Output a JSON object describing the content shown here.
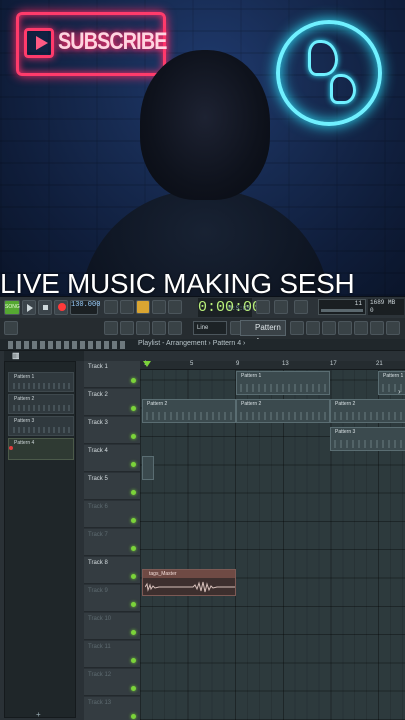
{
  "overlay": {
    "headline": "LIVE MUSIC MAKING SESH",
    "sign_text": "SUBSCRIBE"
  },
  "transport": {
    "song_label": "SONG",
    "tempo": "130.000",
    "time": "0:00:00",
    "time_unit": "M:S:CS",
    "snap": "Line",
    "pattern_selector": "Pattern 4",
    "memory": "1689 MB",
    "cpu_value": "11",
    "voices": "0"
  },
  "breadcrumb": {
    "text": "Playlist - Arrangement  ›  Pattern 4  ›"
  },
  "picker": {
    "items": [
      "Pattern 1",
      "Pattern 2",
      "Pattern 3",
      "Pattern 4"
    ]
  },
  "ruler": [
    "1",
    "5",
    "9",
    "13",
    "17",
    "21"
  ],
  "tracks": [
    "Track 1",
    "Track 2",
    "Track 3",
    "Track 4",
    "Track 5",
    "Track 6",
    "Track 7",
    "Track 8",
    "Track 9",
    "Track 10",
    "Track 11",
    "Track 12",
    "Track 13"
  ],
  "clips": {
    "p1a": "Pattern 1",
    "p1b": "Pattern 1",
    "p2a": "Pattern 2",
    "p2b": "Pattern 2",
    "p2c": "Pattern 2",
    "p3a": "Pattern 3",
    "audio": "tags_Master"
  },
  "colors": {
    "accent_green": "#7bd33a",
    "neon_pink": "#ff3b6b",
    "neon_cyan": "#6ff0ff",
    "time_green": "#b9f07a"
  },
  "icons": [
    "play-icon",
    "stop-icon",
    "record-icon",
    "plus-icon",
    "chevron-right-icon"
  ]
}
